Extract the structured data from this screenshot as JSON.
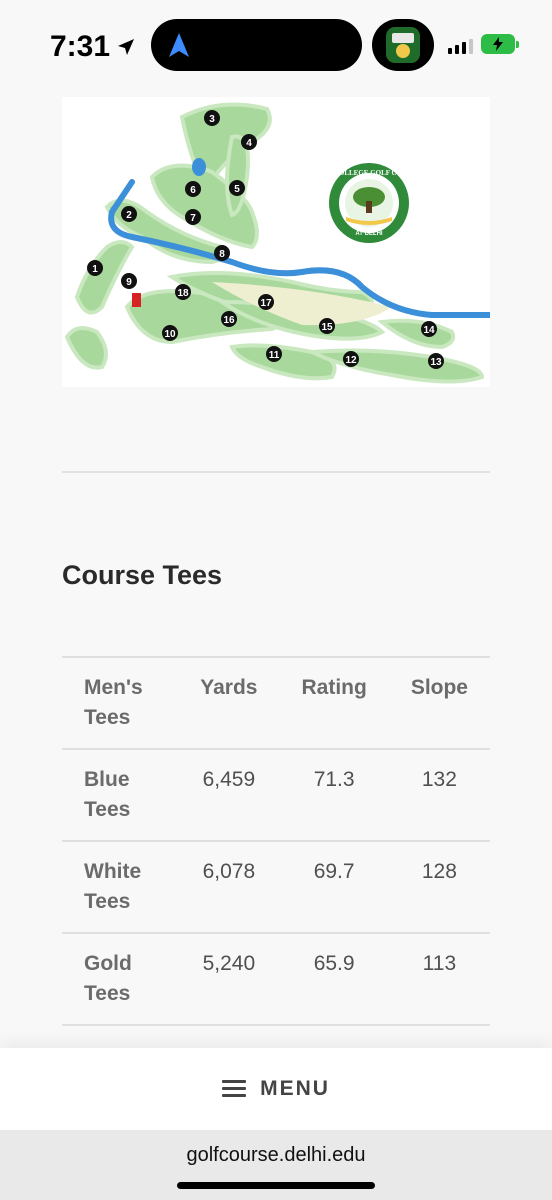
{
  "status_bar": {
    "time": "7:31",
    "location_icon": "location-arrow-icon",
    "nav_icon": "navigation-arrow-icon",
    "app_icon": "golf-app-icon",
    "signal_icon": "cellular-signal-icon",
    "battery_icon": "battery-charging-icon",
    "battery_color": "#2dbd46"
  },
  "map": {
    "logo_arc_text": "THE COLLEGE GOLF COURSE",
    "logo_bottom_text": "AT DELHI",
    "holes": [
      "1",
      "2",
      "3",
      "4",
      "5",
      "6",
      "7",
      "8",
      "9",
      "10",
      "11",
      "12",
      "13",
      "14",
      "15",
      "16",
      "17",
      "18"
    ]
  },
  "section_title": "Course Tees",
  "tees_table": {
    "headers": [
      "Men's Tees",
      "Yards",
      "Rating",
      "Slope"
    ],
    "rows": [
      {
        "name": "Blue Tees",
        "yards": "6,459",
        "rating": "71.3",
        "slope": "132"
      },
      {
        "name": "White Tees",
        "yards": "6,078",
        "rating": "69.7",
        "slope": "128"
      },
      {
        "name": "Gold Tees",
        "yards": "5,240",
        "rating": "65.9",
        "slope": "113"
      }
    ]
  },
  "menu": {
    "label": "MENU",
    "icon": "hamburger-menu-icon"
  },
  "browser": {
    "url": "golfcourse.delhi.edu"
  }
}
